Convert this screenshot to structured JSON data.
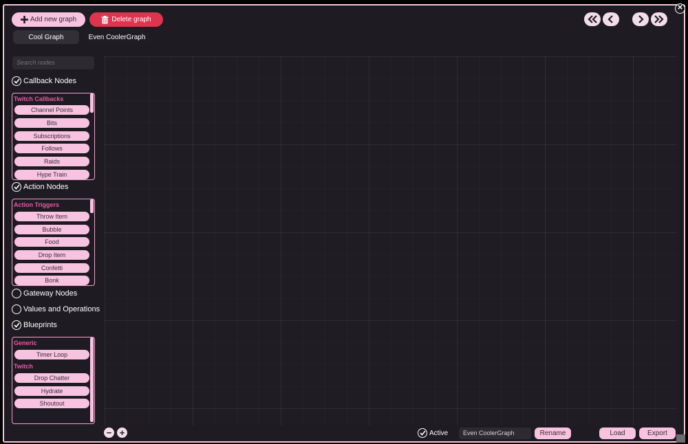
{
  "toolbar": {
    "add_graph": "Add new graph",
    "delete_graph": "Delete graph"
  },
  "tabs": [
    "Cool Graph",
    "Even CoolerGraph"
  ],
  "active_tab": 0,
  "search": {
    "placeholder": "Search nodes"
  },
  "sections": {
    "callback": {
      "label": "Callback Nodes",
      "checked": true
    },
    "action": {
      "label": "Action Nodes",
      "checked": true
    },
    "gateway": {
      "label": "Gateway Nodes",
      "checked": false
    },
    "values": {
      "label": "Values and Operations",
      "checked": false
    },
    "blueprints": {
      "label": "Blueprints",
      "checked": true
    }
  },
  "callback_box": {
    "group": "Twitch Callbacks",
    "items": [
      "Channel Points",
      "Bits",
      "Subscriptions",
      "Follows",
      "Raids",
      "Hype Train"
    ]
  },
  "action_box": {
    "group": "Action Triggers",
    "items": [
      "Throw Item",
      "Bubble",
      "Food",
      "Drop Item",
      "Confetti",
      "Bonk"
    ]
  },
  "blueprint_box": {
    "group1": "Generic",
    "group1_items": [
      "Timer Loop"
    ],
    "group2": "Twitch",
    "group2_items": [
      "Drop Chatter",
      "Hydrate",
      "Shoutout"
    ]
  },
  "footer": {
    "active_label": "Active",
    "active_checked": true,
    "graph_name": "Even CoolerGraph",
    "rename": "Rename",
    "load": "Load",
    "export": "Export"
  },
  "colors": {
    "accent_pink": "#f7c3e1",
    "delete_red": "#dd3550",
    "group_title": "#e65aa8",
    "background": "#1f1b22"
  }
}
